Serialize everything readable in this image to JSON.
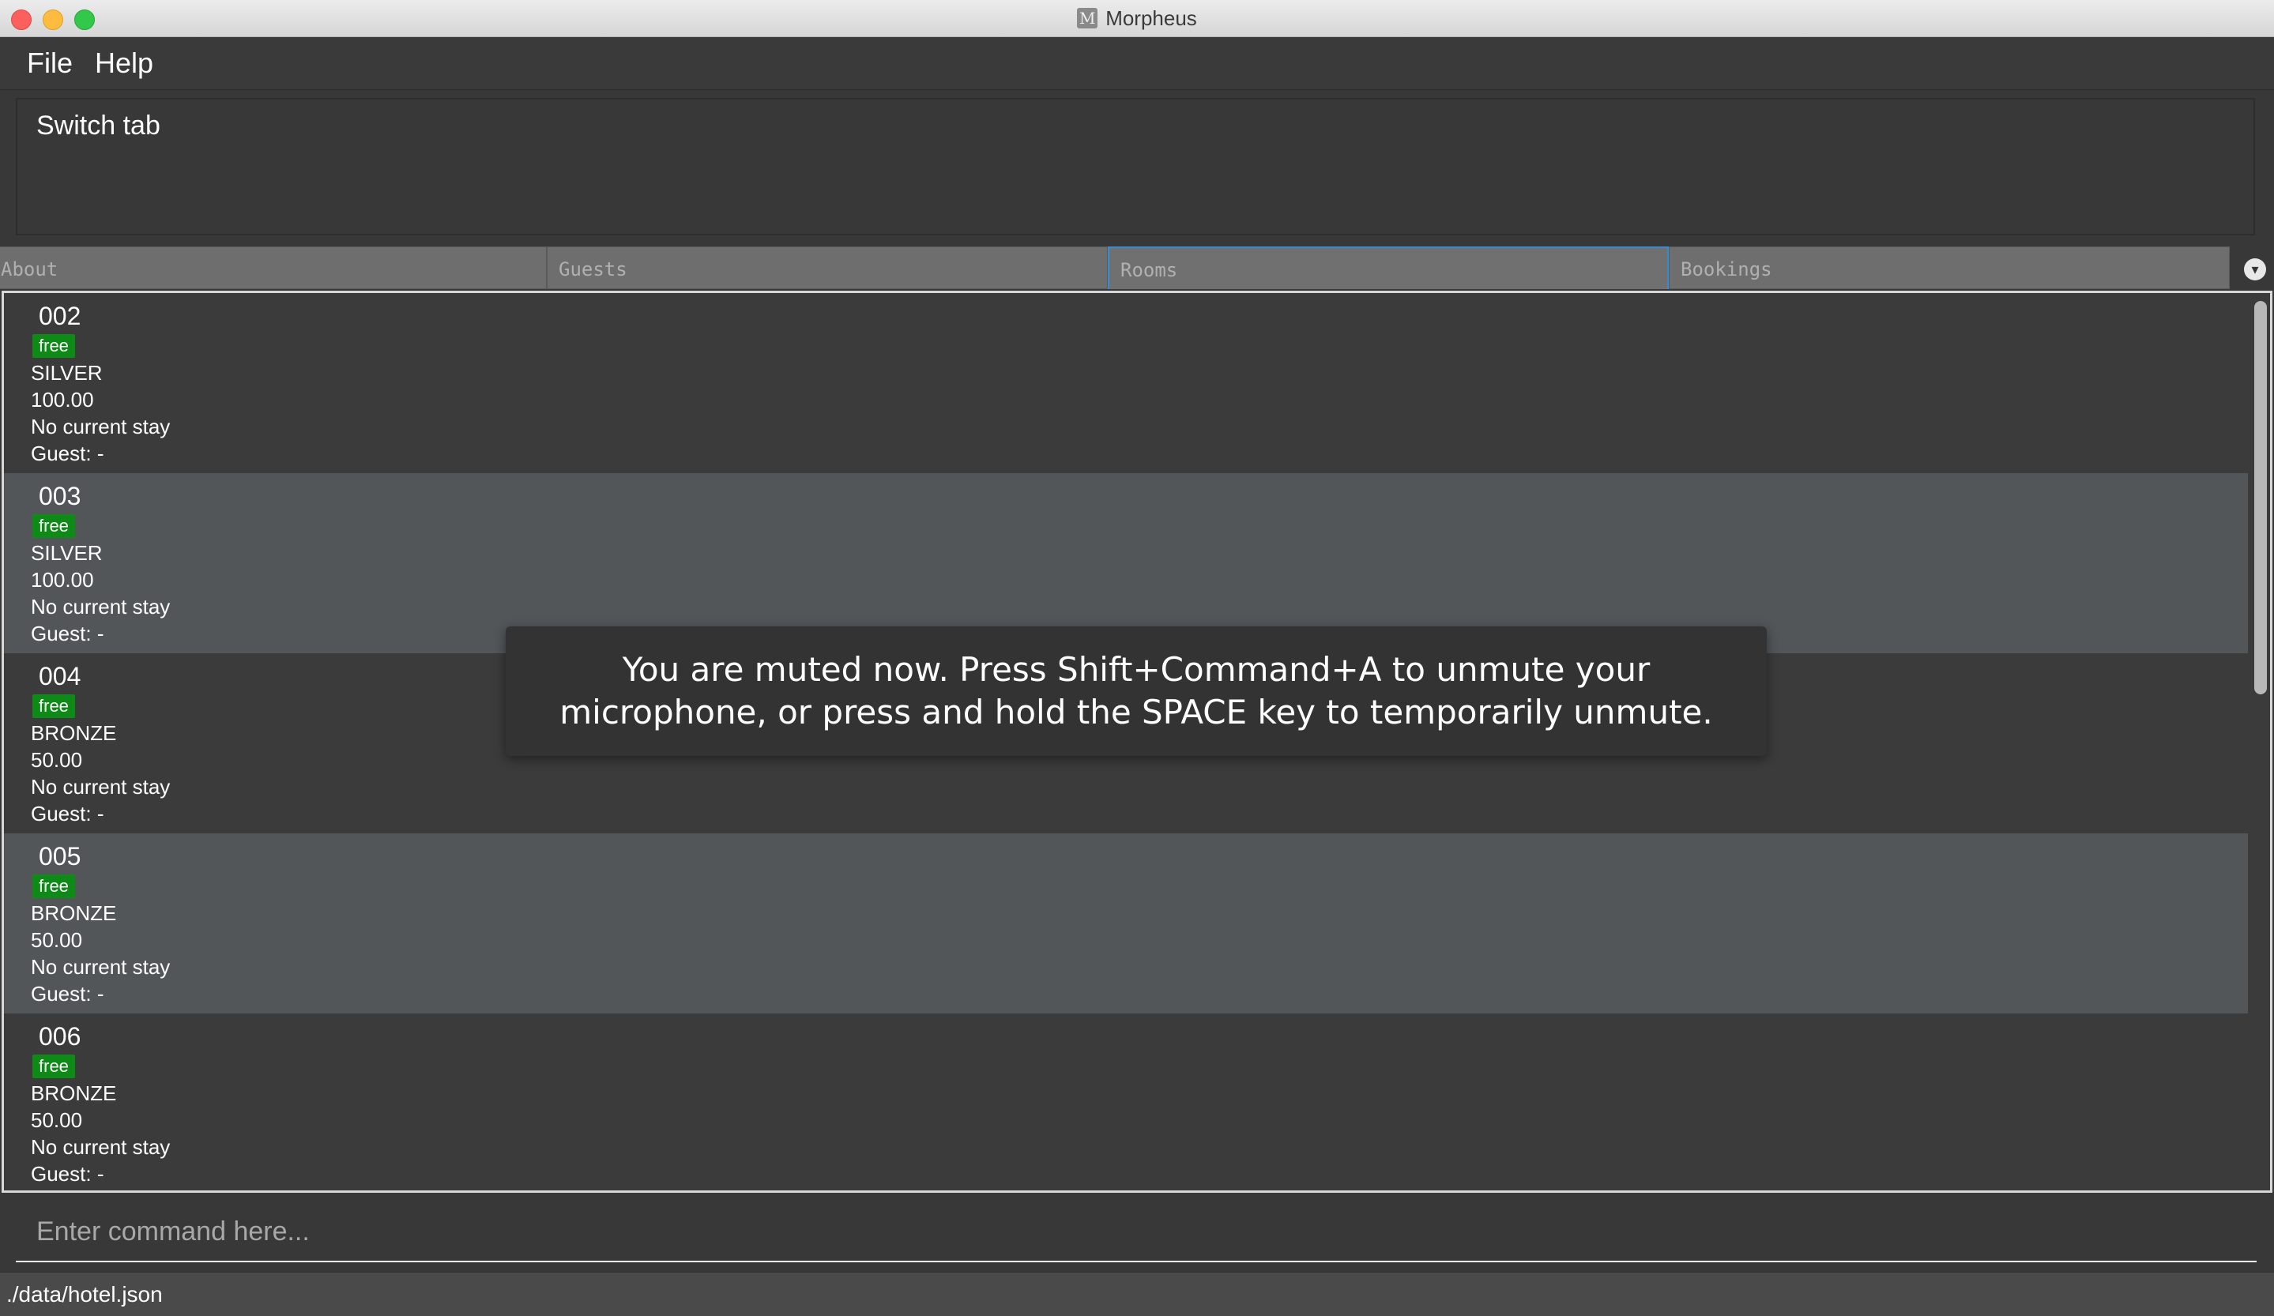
{
  "window": {
    "title": "Morpheus",
    "app_icon_letter": "M"
  },
  "menu": {
    "items": [
      "File",
      "Help"
    ]
  },
  "result_display": {
    "text": "Switch tab"
  },
  "tabs": [
    "About",
    "Guests",
    "Rooms",
    "Bookings"
  ],
  "selected_tab": "Rooms",
  "rooms": [
    {
      "id": "002",
      "status": "free",
      "tier": "SILVER",
      "price": "100.00",
      "stay": "No current stay",
      "guest": "Guest: -"
    },
    {
      "id": "003",
      "status": "free",
      "tier": "SILVER",
      "price": "100.00",
      "stay": "No current stay",
      "guest": "Guest: -"
    },
    {
      "id": "004",
      "status": "free",
      "tier": "BRONZE",
      "price": "50.00",
      "stay": "No current stay",
      "guest": "Guest: -"
    },
    {
      "id": "005",
      "status": "free",
      "tier": "BRONZE",
      "price": "50.00",
      "stay": "No current stay",
      "guest": "Guest: -"
    },
    {
      "id": "006",
      "status": "free",
      "tier": "BRONZE",
      "price": "50.00",
      "stay": "No current stay",
      "guest": "Guest: -"
    }
  ],
  "command_box": {
    "placeholder": "Enter command here...",
    "value": ""
  },
  "status_bar": {
    "path": "./data/hotel.json"
  },
  "toast": {
    "message": "You are muted now. Press Shift+Command+A to unmute your microphone, or press and hold the SPACE key to temporarily unmute."
  },
  "colors": {
    "free_badge": "#0e8a16",
    "selected_tab_border": "#3b8bd0",
    "alt_row": "#525659",
    "background": "#383838"
  }
}
